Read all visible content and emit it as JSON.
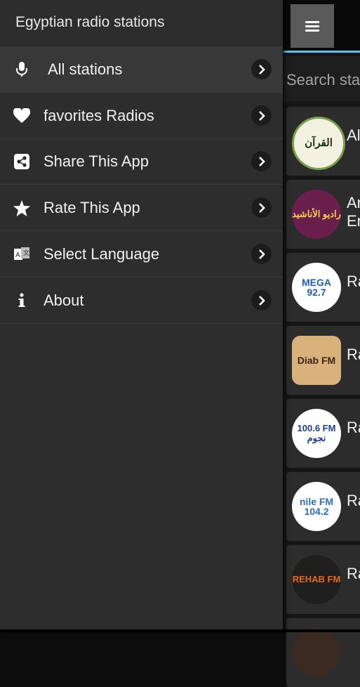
{
  "drawer": {
    "title": "Egyptian radio stations",
    "items": [
      {
        "label": "All stations",
        "icon": "microphone-icon",
        "active": true
      },
      {
        "label": "favorites Radios",
        "icon": "heart-icon"
      },
      {
        "label": "Share This App",
        "icon": "share-icon"
      },
      {
        "label": "Rate This App",
        "icon": "star-icon"
      },
      {
        "label": "Select Language",
        "icon": "language-icon"
      },
      {
        "label": "About",
        "icon": "info-icon"
      }
    ]
  },
  "main": {
    "menu_icon": "hamburger-menu-icon",
    "accent_color": "#5fc6ea",
    "search": {
      "placeholder": "Search stations"
    },
    "stations": [
      {
        "name": "Al",
        "logo_text": "القرآن"
      },
      {
        "name": "Ar\nEn",
        "logo_text": "راديو الأناشيد"
      },
      {
        "name": "Ra",
        "logo_text": "MEGA 92.7"
      },
      {
        "name": "Ra",
        "logo_text": "Diab FM"
      },
      {
        "name": "Ra",
        "logo_text": "100.6 FM نجوم"
      },
      {
        "name": "Ra",
        "logo_text": "nile FM 104.2"
      },
      {
        "name": "Ra",
        "logo_text": "REHAB FM"
      }
    ]
  }
}
